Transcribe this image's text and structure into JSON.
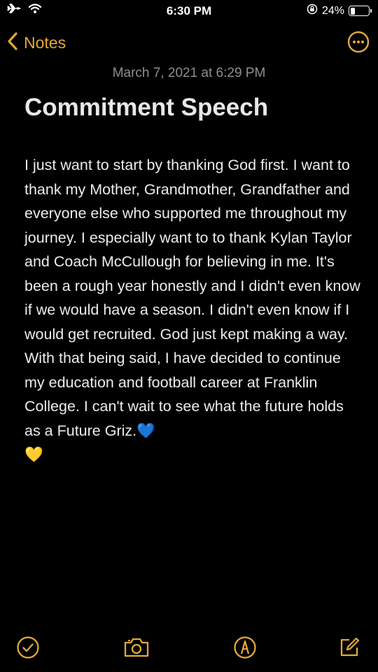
{
  "status_bar": {
    "time": "6:30 PM",
    "battery_percent": "24%",
    "battery_level": 0.24,
    "icons": [
      "airplane-icon",
      "wifi-icon",
      "orientation-lock-icon",
      "battery-icon"
    ]
  },
  "nav": {
    "back_label": "Notes",
    "more_icon": "ellipsis-circle-icon"
  },
  "note": {
    "date": "March 7, 2021 at 6:29 PM",
    "title": "Commitment Speech",
    "body": "I just want to start by thanking God first. I want to thank my Mother, Grandmother, Grandfather and everyone else who supported me throughout my journey. I especially want to to thank Kylan Taylor and Coach McCullough for believing in me. It's been a rough year honestly and I didn't even know if we would have a season. I didn't even know if I would get recruited. God just kept making a way. With that being said, I have decided to continue my education and football career at Franklin College. I can't wait to see what the future holds as a Future Griz.",
    "emoji_1": "💙",
    "emoji_2": "💛"
  },
  "toolbar": {
    "icons": [
      "checklist-icon",
      "camera-icon",
      "markup-icon",
      "compose-icon"
    ]
  },
  "colors": {
    "accent": "#e3a93a",
    "background": "#000000",
    "secondary_text": "#8e8e93"
  }
}
